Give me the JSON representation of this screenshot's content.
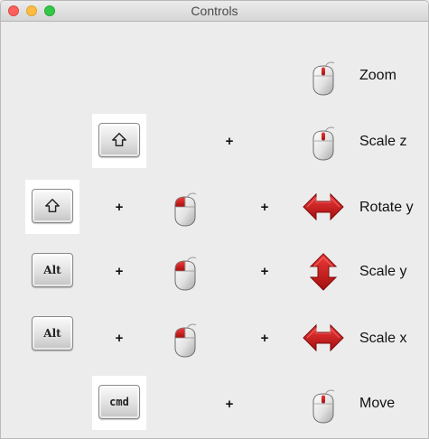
{
  "window": {
    "title": "Controls",
    "buttons": [
      "close",
      "minimize",
      "maximize"
    ]
  },
  "rows": [
    {
      "modifier": null,
      "mouse_click": false,
      "action_icon": "mouse-icon",
      "label": "Zoom"
    },
    {
      "modifier": "shift-icon",
      "mouse_click": false,
      "action_icon": "mouse-icon",
      "label": "Scale z"
    },
    {
      "modifier": "shift-icon",
      "mouse_click": true,
      "action_icon": "horizontal-double-arrow-icon",
      "label": "Rotate y"
    },
    {
      "modifier": "Alt",
      "mouse_click": true,
      "action_icon": "vertical-double-arrow-icon",
      "label": "Scale y"
    },
    {
      "modifier": "Alt",
      "mouse_click": true,
      "action_icon": "horizontal-double-arrow-icon",
      "label": "Scale x"
    },
    {
      "modifier": "cmd",
      "mouse_click": false,
      "action_icon": "mouse-icon",
      "label": "Move"
    }
  ],
  "keys": {
    "alt": "Alt",
    "cmd": "cmd"
  },
  "plus_sign": "+",
  "colors": {
    "arrow": "#cc1f1f",
    "mouse_button": "#cc1f1f",
    "key_tile": "#ffffff"
  }
}
